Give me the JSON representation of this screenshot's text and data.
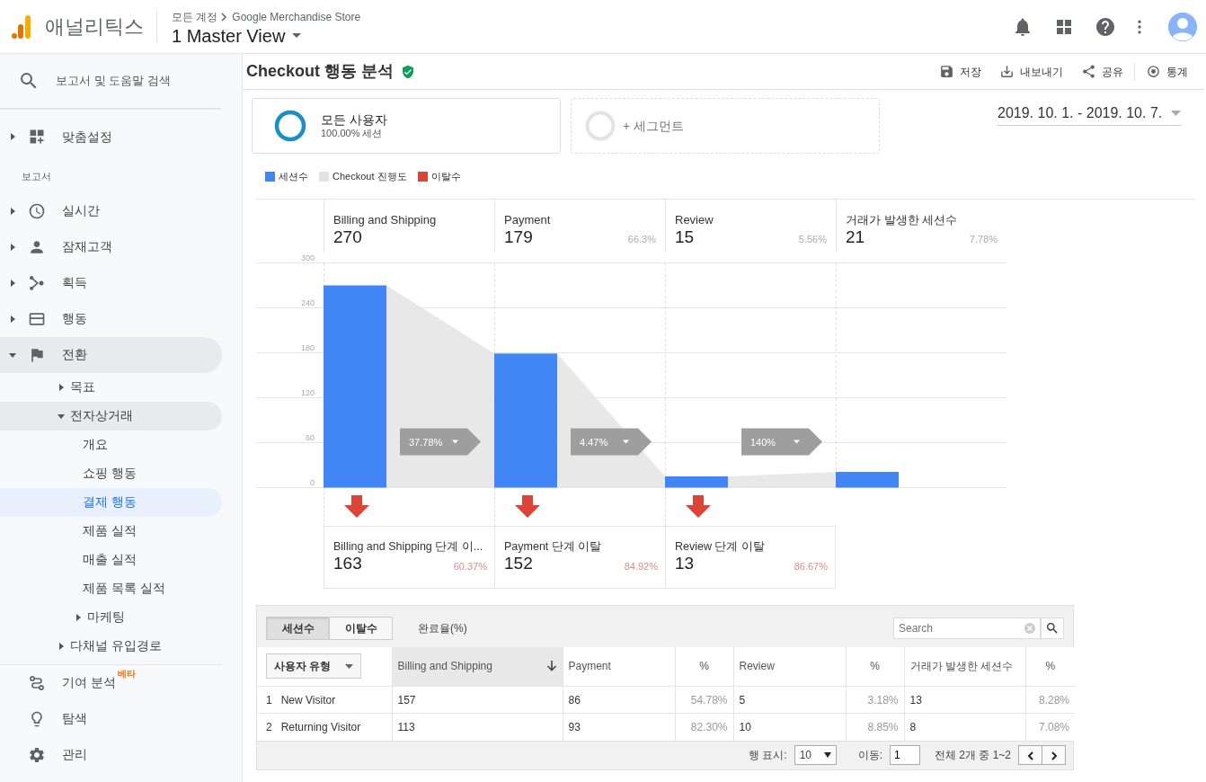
{
  "header": {
    "product": "애널리틱스",
    "breadcrumb": [
      "모든 계정",
      "Google Merchandise Store"
    ],
    "view": "1 Master View"
  },
  "sidebar": {
    "search": {
      "placeholder": "보고서 및 도움말 검색"
    },
    "customization": {
      "label": "맞춤설정",
      "expanded": false,
      "selected": false
    },
    "section_label": "보고서",
    "reports": [
      {
        "label": "실시간",
        "expanded": false,
        "selected": false
      },
      {
        "label": "잠재고객",
        "expanded": false,
        "selected": false
      },
      {
        "label": "획득",
        "expanded": false,
        "selected": false
      },
      {
        "label": "행동",
        "expanded": false,
        "selected": false
      },
      {
        "label": "전환",
        "expanded": true,
        "selected": false,
        "children": [
          {
            "label": "목표",
            "expanded": false,
            "selected": false
          },
          {
            "label": "전자상거래",
            "expanded": true,
            "selected": false,
            "children": [
              {
                "label": "개요",
                "selected": false
              },
              {
                "label": "쇼핑 행동",
                "selected": false
              },
              {
                "label": "결제 행동",
                "selected": true
              },
              {
                "label": "제품 실적",
                "selected": false
              },
              {
                "label": "매출 실적",
                "selected": false
              },
              {
                "label": "제품 목록 실적",
                "selected": false
              },
              {
                "label": "마케팅",
                "expanded": false,
                "selected": false
              }
            ]
          },
          {
            "label": "다채널 유입경로",
            "expanded": false,
            "selected": false
          }
        ]
      }
    ],
    "bottom_items": [
      {
        "label": "기여 분석",
        "badge": "베타",
        "selected": false
      },
      {
        "label": "탐색",
        "selected": false
      },
      {
        "label": "관리",
        "selected": false
      }
    ]
  },
  "report": {
    "title": "Checkout 행동 분석",
    "verified": true,
    "actions": [
      {
        "label": "저장"
      },
      {
        "label": "내보내기"
      },
      {
        "label": "공유"
      },
      {
        "label": "통계"
      }
    ],
    "segments": [
      {
        "kind": "active",
        "name": "모든 사용자",
        "detail": "100.00% 세션"
      },
      {
        "kind": "add",
        "name": "+ 세그먼트"
      }
    ],
    "date_range": "2019. 10. 1. - 2019. 10. 7.",
    "legend": [
      {
        "label": "세션수",
        "color": "#4285f4"
      },
      {
        "label": "Checkout 진행도",
        "color": "#e3e3e3"
      },
      {
        "label": "이탈수",
        "color": "#db4437"
      }
    ],
    "steps": [
      {
        "name": "Billing and Shipping",
        "value": "270"
      },
      {
        "name": "Payment",
        "value": "179",
        "share": "66.3%"
      },
      {
        "name": "Review",
        "value": "15",
        "share": "5.56%"
      },
      {
        "name": "거래가 발생한 세션수",
        "value": "21",
        "share": "7.78%"
      }
    ],
    "chart_data": {
      "type": "bar",
      "values": [
        270,
        179,
        15,
        21
      ],
      "ylim": [
        0,
        300
      ],
      "grid": true,
      "yticks": [
        0,
        60,
        120,
        180,
        240,
        300
      ]
    },
    "conversion_rates": [
      "37.78%",
      "4.47%",
      "140%"
    ],
    "drop_offs": [
      {
        "label": "Billing and Shipping 단계 이...",
        "value": "163",
        "share": "60.37%"
      },
      {
        "label": "Payment 단계 이탈",
        "value": "152",
        "share": "84.92%"
      },
      {
        "label": "Review 단계 이탈",
        "value": "13",
        "share": "86.67%"
      }
    ]
  },
  "table": {
    "metric_tabs": [
      {
        "label": "세션수",
        "selected": true,
        "kind": "toggle"
      },
      {
        "label": "이탈수",
        "selected": false,
        "kind": "toggle"
      },
      {
        "label": "완료율(%)",
        "selected": false,
        "kind": "link"
      }
    ],
    "search": {
      "placeholder": "Search"
    },
    "dimension": "사용자 유형",
    "columns": [
      {
        "label": "Billing and Shipping",
        "kind": "metric",
        "sorted": true
      },
      {
        "label": "Payment",
        "kind": "metric",
        "sorted": false
      },
      {
        "label": "%",
        "kind": "percent",
        "sorted": false
      },
      {
        "label": "Review",
        "kind": "metric",
        "sorted": false
      },
      {
        "label": "%",
        "kind": "percent",
        "sorted": false
      },
      {
        "label": "거래가 발생한 세션수",
        "kind": "metric",
        "sorted": false
      },
      {
        "label": "%",
        "kind": "percent",
        "sorted": false
      }
    ],
    "rows": [
      {
        "index": "1",
        "name": "New Visitor",
        "cells": [
          "157",
          "86",
          "54.78%",
          "5",
          "3.18%",
          "13",
          "8.28%"
        ]
      },
      {
        "index": "2",
        "name": "Returning Visitor",
        "cells": [
          "113",
          "93",
          "82.30%",
          "10",
          "8.85%",
          "8",
          "7.08%"
        ]
      }
    ],
    "footer": {
      "rows_label": "행 표시:",
      "rows_value": "10",
      "goto_label": "이동:",
      "goto_value": "1",
      "range": "전체 2개 중 1~2"
    }
  }
}
